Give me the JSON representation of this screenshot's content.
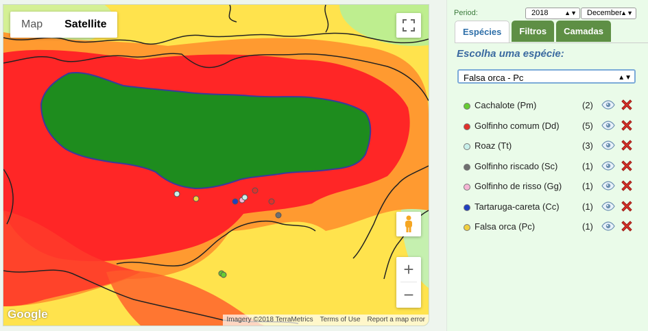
{
  "map": {
    "map_type_tabs": [
      {
        "label": "Map",
        "selected": false
      },
      {
        "label": "Satellite",
        "selected": true
      }
    ],
    "fullscreen_icon": "fullscreen-icon",
    "pegman_icon": "pegman-icon",
    "zoom_in_label": "+",
    "zoom_out_label": "−",
    "google_logo": "Google",
    "attribution": {
      "imagery": "Imagery ©2018 TerraMetrics",
      "terms": "Terms of Use",
      "report": "Report a map error"
    },
    "colors": {
      "land": "#1e8c1e",
      "coast": "#3a3a9a",
      "hot": "#ff2020",
      "warm": "#ff9a20",
      "mild": "#ffe34d",
      "cool": "#aef0a0"
    }
  },
  "sidebar": {
    "period_label": "Period:",
    "year": "2018",
    "month": "December",
    "tabs": [
      {
        "label": "Espécies",
        "active": true
      },
      {
        "label": "Filtros",
        "active": false
      },
      {
        "label": "Camadas",
        "active": false
      }
    ],
    "choose_label": "Escolha uma espécie:",
    "species_select_value": "Falsa orca - Pc",
    "species": [
      {
        "name": "Cachalote (Pm)",
        "count": "(2)",
        "color": "#66cc33"
      },
      {
        "name": "Golfinho comum (Dd)",
        "count": "(5)",
        "color": "#e0302a"
      },
      {
        "name": "Roaz (Tt)",
        "count": "(3)",
        "color": "#c8f0ea"
      },
      {
        "name": "Golfinho riscado (Sc)",
        "count": "(1)",
        "color": "#6f6f6f"
      },
      {
        "name": "Golfinho de risso (Gg)",
        "count": "(1)",
        "color": "#f5b6d4"
      },
      {
        "name": "Tartaruga-careta (Cc)",
        "count": "(1)",
        "color": "#2040c0"
      },
      {
        "name": "Falsa orca (Pc)",
        "count": "(1)",
        "color": "#f0d040"
      }
    ]
  }
}
